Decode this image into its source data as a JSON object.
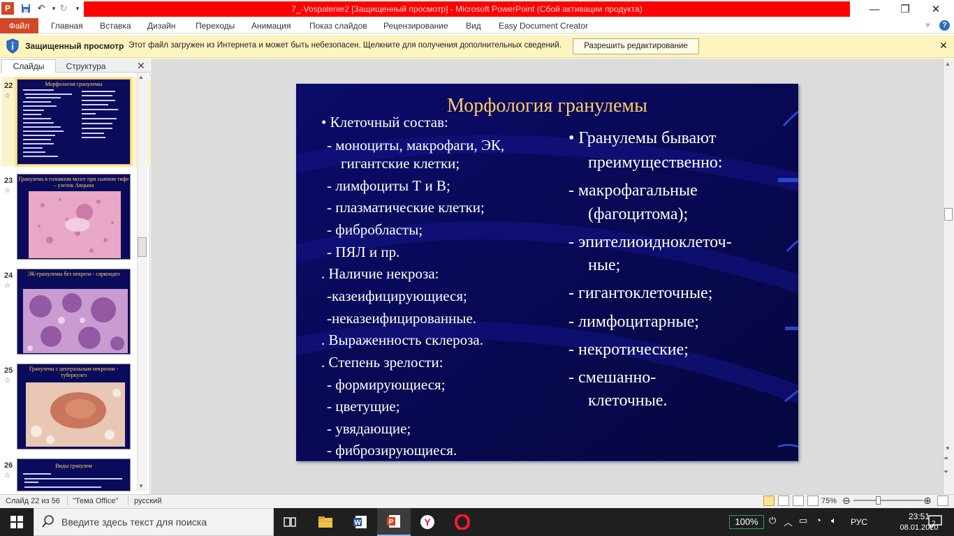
{
  "window": {
    "title": "7_-Vospalenie2 [Защищенный просмотр] - Microsoft PowerPoint (Сбой активации продукта)"
  },
  "ribbon": {
    "file_tab": "Файл",
    "tabs": [
      "Главная",
      "Вставка",
      "Дизайн",
      "Переходы",
      "Анимация",
      "Показ слайдов",
      "Рецензирование",
      "Вид",
      "Easy Document Creator"
    ]
  },
  "protected_view": {
    "title": "Защищенный просмотр",
    "message": "Этот файл загружен из Интернета и может быть небезопасен. Щелкните для получения дополнительных сведений.",
    "enable_button": "Разрешить редактирование"
  },
  "left_pane": {
    "tab_slides": "Слайды",
    "tab_outline": "Структура",
    "thumbnails": [
      {
        "number": "22",
        "title": "Морфология гранулемы"
      },
      {
        "number": "23",
        "title": "Гранулема в головном мозге при сыпном тифе – узелок Авцына"
      },
      {
        "number": "24",
        "title": "ЭК-гранулемы без некроза - саркоидоз"
      },
      {
        "number": "25",
        "title": "Гранулема с центральным некрозом - туберкулез"
      },
      {
        "number": "26",
        "title": "Виды гранулем"
      }
    ]
  },
  "slide": {
    "title": "Морфология гранулемы",
    "left_column": [
      "•   Клеточный состав:",
      "-  моноциты, макрофаги, ЭК,",
      "гигантские клетки;",
      "- лимфоциты Т и В;",
      "- плазматические клетки;",
      "- фибробласты;",
      "- ПЯЛ и пр.",
      ".  Наличие некроза:",
      "-казеифицирующиеся;",
      "-неказеифицированные.",
      ".  Выраженность склероза.",
      ".  Степень зрелости:",
      "- формирующиеся;",
      "- цветущие;",
      "- увядающие;",
      "- фиброзирующиеся."
    ],
    "right_column": [
      "•  Гранулемы бывают",
      "преимущественно:",
      "-    макрофагальные",
      "(фагоцитома);",
      "-    эпителиоидноклеточ-",
      "ные;",
      "-    гигантоклеточные;",
      "-    лимфоцитарные;",
      "-    некротические;",
      "-    смешанно-",
      "клеточные."
    ]
  },
  "status_bar": {
    "slide_info": "Слайд 22 из 56",
    "theme": "\"Тема Office\"",
    "language": "русский",
    "zoom": "75%"
  },
  "taskbar": {
    "search_placeholder": "Введите здесь текст для поиска",
    "battery": "100%",
    "input_lang": "РУС",
    "time": "23:51",
    "date": "08.01.2020",
    "notifications": "2"
  }
}
